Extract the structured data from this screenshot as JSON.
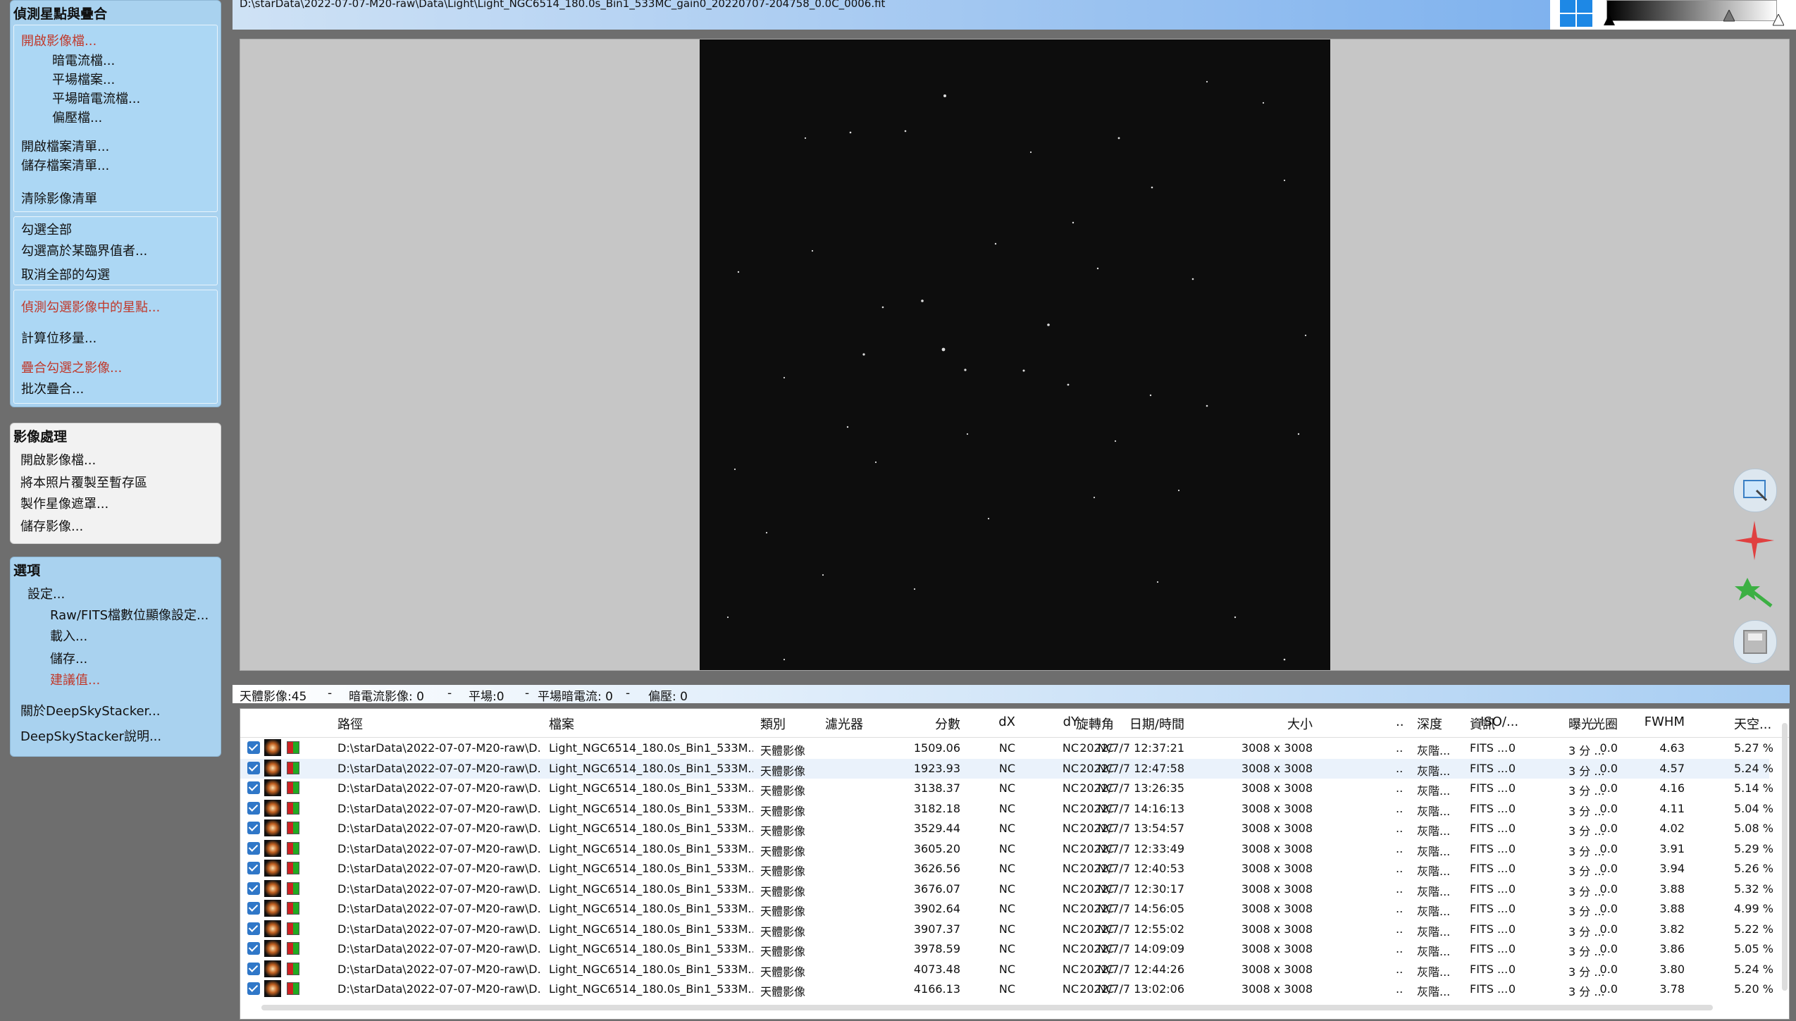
{
  "sidebar": {
    "panel1": {
      "title": "偵測星點與疊合",
      "group1": [
        "開啟影像檔...",
        "暗電流檔...",
        "平場檔案...",
        "平場暗電流檔...",
        "偏壓檔...",
        "開啟檔案清單...",
        "儲存檔案清單...",
        "清除影像清單"
      ],
      "group2": [
        "勾選全部",
        "勾選高於某臨界值者...",
        "取消全部的勾選"
      ],
      "group3": [
        "偵測勾選影像中的星點...",
        "計算位移量...",
        "疊合勾選之影像...",
        "批次疊合..."
      ]
    },
    "panel2": {
      "title": "影像處理",
      "items": [
        "開啟影像檔...",
        "將本照片覆製至暫存區",
        "製作星像遮罩...",
        "儲存影像..."
      ]
    },
    "panel3": {
      "title": "選項",
      "items": [
        "設定...",
        "Raw/FITS檔數位顯像設定...",
        "載入...",
        "儲存...",
        "建議值...",
        "關於DeepSkyStacker...",
        "DeepSkyStacker說明..."
      ]
    }
  },
  "header": {
    "path": "D:\\starData\\2022-07-07-M20-raw\\Data\\Light\\Light_NGC6514_180.0s_Bin1_533MC_gain0_20220707-204758_0.0C_0006.fit"
  },
  "status": {
    "light": "天體影像:45",
    "dark": "暗電流影像: 0",
    "flat": "平場:0",
    "darkflat": "平場暗電流: 0",
    "bias": "偏壓: 0",
    "sep": "-"
  },
  "table": {
    "headers": [
      "路徑",
      "檔案",
      "類別",
      "濾光器",
      "分數",
      "dX",
      "dY",
      "旋轉角",
      "日期/時間",
      "大小",
      "..",
      "深度",
      "資訊",
      "ISO/...",
      "曝光",
      "光圈",
      "FWHM",
      "天空..."
    ],
    "rows": [
      [
        "D:\\starData\\2022-07-07-M20-raw\\D...",
        "Light_NGC6514_180.0s_Bin1_533M...",
        "天體影像",
        "",
        "1509.06",
        "NC",
        "NC",
        "NC",
        "2022/7/7 12:37:21",
        "3008 x 3008",
        "..",
        "灰階...",
        "FITS ...",
        "0",
        "3 分 ...",
        "0.0",
        "4.63",
        "5.27 %"
      ],
      [
        "D:\\starData\\2022-07-07-M20-raw\\D...",
        "Light_NGC6514_180.0s_Bin1_533M...",
        "天體影像",
        "",
        "1923.93",
        "NC",
        "NC",
        "NC",
        "2022/7/7 12:47:58",
        "3008 x 3008",
        "..",
        "灰階...",
        "FITS ...",
        "0",
        "3 分 ...",
        "0.0",
        "4.57",
        "5.24 %"
      ],
      [
        "D:\\starData\\2022-07-07-M20-raw\\D...",
        "Light_NGC6514_180.0s_Bin1_533M...",
        "天體影像",
        "",
        "3138.37",
        "NC",
        "NC",
        "NC",
        "2022/7/7 13:26:35",
        "3008 x 3008",
        "..",
        "灰階...",
        "FITS ...",
        "0",
        "3 分 ...",
        "0.0",
        "4.16",
        "5.14 %"
      ],
      [
        "D:\\starData\\2022-07-07-M20-raw\\D...",
        "Light_NGC6514_180.0s_Bin1_533M...",
        "天體影像",
        "",
        "3182.18",
        "NC",
        "NC",
        "NC",
        "2022/7/7 14:16:13",
        "3008 x 3008",
        "..",
        "灰階...",
        "FITS ...",
        "0",
        "3 分 ...",
        "0.0",
        "4.11",
        "5.04 %"
      ],
      [
        "D:\\starData\\2022-07-07-M20-raw\\D...",
        "Light_NGC6514_180.0s_Bin1_533M...",
        "天體影像",
        "",
        "3529.44",
        "NC",
        "NC",
        "NC",
        "2022/7/7 13:54:57",
        "3008 x 3008",
        "..",
        "灰階...",
        "FITS ...",
        "0",
        "3 分 ...",
        "0.0",
        "4.02",
        "5.08 %"
      ],
      [
        "D:\\starData\\2022-07-07-M20-raw\\D...",
        "Light_NGC6514_180.0s_Bin1_533M...",
        "天體影像",
        "",
        "3605.20",
        "NC",
        "NC",
        "NC",
        "2022/7/7 12:33:49",
        "3008 x 3008",
        "..",
        "灰階...",
        "FITS ...",
        "0",
        "3 分 ...",
        "0.0",
        "3.91",
        "5.29 %"
      ],
      [
        "D:\\starData\\2022-07-07-M20-raw\\D...",
        "Light_NGC6514_180.0s_Bin1_533M...",
        "天體影像",
        "",
        "3626.56",
        "NC",
        "NC",
        "NC",
        "2022/7/7 12:40:53",
        "3008 x 3008",
        "..",
        "灰階...",
        "FITS ...",
        "0",
        "3 分 ...",
        "0.0",
        "3.94",
        "5.26 %"
      ],
      [
        "D:\\starData\\2022-07-07-M20-raw\\D...",
        "Light_NGC6514_180.0s_Bin1_533M...",
        "天體影像",
        "",
        "3676.07",
        "NC",
        "NC",
        "NC",
        "2022/7/7 12:30:17",
        "3008 x 3008",
        "..",
        "灰階...",
        "FITS ...",
        "0",
        "3 分 ...",
        "0.0",
        "3.88",
        "5.32 %"
      ],
      [
        "D:\\starData\\2022-07-07-M20-raw\\D...",
        "Light_NGC6514_180.0s_Bin1_533M...",
        "天體影像",
        "",
        "3902.64",
        "NC",
        "NC",
        "NC",
        "2022/7/7 14:56:05",
        "3008 x 3008",
        "..",
        "灰階...",
        "FITS ...",
        "0",
        "3 分 ...",
        "0.0",
        "3.88",
        "4.99 %"
      ],
      [
        "D:\\starData\\2022-07-07-M20-raw\\D...",
        "Light_NGC6514_180.0s_Bin1_533M...",
        "天體影像",
        "",
        "3907.37",
        "NC",
        "NC",
        "NC",
        "2022/7/7 12:55:02",
        "3008 x 3008",
        "..",
        "灰階...",
        "FITS ...",
        "0",
        "3 分 ...",
        "0.0",
        "3.82",
        "5.22 %"
      ],
      [
        "D:\\starData\\2022-07-07-M20-raw\\D...",
        "Light_NGC6514_180.0s_Bin1_533M...",
        "天體影像",
        "",
        "3978.59",
        "NC",
        "NC",
        "NC",
        "2022/7/7 14:09:09",
        "3008 x 3008",
        "..",
        "灰階...",
        "FITS ...",
        "0",
        "3 分 ...",
        "0.0",
        "3.86",
        "5.05 %"
      ],
      [
        "D:\\starData\\2022-07-07-M20-raw\\D...",
        "Light_NGC6514_180.0s_Bin1_533M...",
        "天體影像",
        "",
        "4073.48",
        "NC",
        "NC",
        "NC",
        "2022/7/7 12:44:26",
        "3008 x 3008",
        "..",
        "灰階...",
        "FITS ...",
        "0",
        "3 分 ...",
        "0.0",
        "3.80",
        "5.24 %"
      ],
      [
        "D:\\starData\\2022-07-07-M20-raw\\D...",
        "Light_NGC6514_180.0s_Bin1_533M...",
        "天體影像",
        "",
        "4166.13",
        "NC",
        "NC",
        "NC",
        "2022/7/7 13:02:06",
        "3008 x 3008",
        "..",
        "灰階...",
        "FITS ...",
        "0",
        "3 分 ...",
        "0.0",
        "3.78",
        "5.20 %"
      ]
    ]
  },
  "icons": {
    "windows_logo": "windows-icon",
    "tools": [
      "selection-tool-icon",
      "star-edit-icon",
      "comet-edit-icon",
      "save-tool-icon"
    ]
  },
  "colors": {
    "panel_bg": "#a9d2ef",
    "accent_red": "#c0392b"
  }
}
